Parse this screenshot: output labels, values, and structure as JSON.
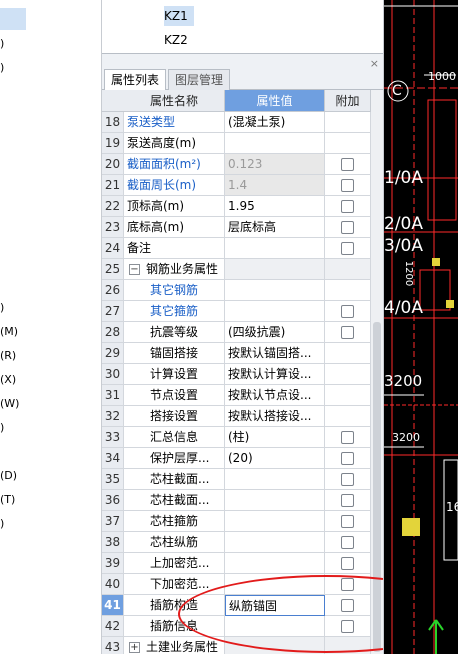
{
  "left_menu": {
    "items": [
      {
        "label": ")"
      },
      {
        "label": ")"
      },
      {
        "label": ")"
      },
      {
        "label": "(M)"
      },
      {
        "label": "(R)"
      },
      {
        "label": "(X)"
      },
      {
        "label": "(W)"
      },
      {
        "label": ")"
      },
      {
        "label": "(D)"
      },
      {
        "label": "(T)"
      },
      {
        "label": ")"
      }
    ]
  },
  "component_list": {
    "items": [
      {
        "label": "KZ1",
        "selected": true
      },
      {
        "label": "KZ2",
        "selected": false
      }
    ]
  },
  "panel": {
    "close_glyph": "×",
    "tabs": [
      {
        "label": "属性列表",
        "active": true
      },
      {
        "label": "图层管理",
        "active": false
      }
    ],
    "headers": {
      "name": "属性名称",
      "value": "属性值",
      "add": "附加"
    }
  },
  "rows": [
    {
      "num": "18",
      "name": "泵送类型",
      "value": "(混凝土泵)",
      "checkbox": false,
      "style": "blue"
    },
    {
      "num": "19",
      "name": "泵送高度(m)",
      "value": "",
      "checkbox": false,
      "style": ""
    },
    {
      "num": "20",
      "name": "截面面积(m²)",
      "value": "0.123",
      "checkbox": true,
      "style": "blue grey"
    },
    {
      "num": "21",
      "name": "截面周长(m)",
      "value": "1.4",
      "checkbox": true,
      "style": "blue grey"
    },
    {
      "num": "22",
      "name": "顶标高(m)",
      "value": "1.95",
      "checkbox": true,
      "style": ""
    },
    {
      "num": "23",
      "name": "底标高(m)",
      "value": "层底标高",
      "checkbox": true,
      "style": ""
    },
    {
      "num": "24",
      "name": "备注",
      "value": "",
      "checkbox": true,
      "style": ""
    },
    {
      "num": "25",
      "name": "钢筋业务属性",
      "value": "",
      "checkbox": false,
      "style": "group",
      "expander": "−"
    },
    {
      "num": "26",
      "name": "其它钢筋",
      "value": "",
      "checkbox": false,
      "style": "blue indent1"
    },
    {
      "num": "27",
      "name": "其它箍筋",
      "value": "",
      "checkbox": true,
      "style": "blue indent1"
    },
    {
      "num": "28",
      "name": "抗震等级",
      "value": "(四级抗震)",
      "checkbox": true,
      "style": "indent1"
    },
    {
      "num": "29",
      "name": "锚固搭接",
      "value": "按默认锚固搭...",
      "checkbox": false,
      "style": "indent1"
    },
    {
      "num": "30",
      "name": "计算设置",
      "value": "按默认计算设...",
      "checkbox": false,
      "style": "indent1"
    },
    {
      "num": "31",
      "name": "节点设置",
      "value": "按默认节点设...",
      "checkbox": false,
      "style": "indent1"
    },
    {
      "num": "32",
      "name": "搭接设置",
      "value": "按默认搭接设...",
      "checkbox": false,
      "style": "indent1"
    },
    {
      "num": "33",
      "name": "汇总信息",
      "value": "(柱)",
      "checkbox": true,
      "style": "indent1"
    },
    {
      "num": "34",
      "name": "保护层厚...",
      "value": "(20)",
      "checkbox": true,
      "style": "indent1"
    },
    {
      "num": "35",
      "name": "芯柱截面...",
      "value": "",
      "checkbox": true,
      "style": "indent1"
    },
    {
      "num": "36",
      "name": "芯柱截面...",
      "value": "",
      "checkbox": true,
      "style": "indent1"
    },
    {
      "num": "37",
      "name": "芯柱箍筋",
      "value": "",
      "checkbox": true,
      "style": "indent1"
    },
    {
      "num": "38",
      "name": "芯柱纵筋",
      "value": "",
      "checkbox": true,
      "style": "indent1"
    },
    {
      "num": "39",
      "name": "上加密范...",
      "value": "",
      "checkbox": true,
      "style": "indent1"
    },
    {
      "num": "40",
      "name": "下加密范...",
      "value": "",
      "checkbox": true,
      "style": "indent1"
    },
    {
      "num": "41",
      "name": "插筋构造",
      "value": "纵筋锚固",
      "checkbox": true,
      "style": "indent1 hl"
    },
    {
      "num": "42",
      "name": "插筋信息",
      "value": "",
      "checkbox": true,
      "style": "indent1"
    },
    {
      "num": "43",
      "name": "土建业务属性",
      "value": "",
      "checkbox": false,
      "style": "group",
      "expander": "+"
    }
  ],
  "cad": {
    "accent": "#ff2a2a",
    "labels": [
      {
        "text": "C"
      },
      {
        "text": "1000"
      },
      {
        "text": "1/0A"
      },
      {
        "text": "2/0A"
      },
      {
        "text": "3/0A"
      },
      {
        "text": "1200"
      },
      {
        "text": "4/0A"
      },
      {
        "text": "3200"
      },
      {
        "text": "3200"
      },
      {
        "text": "16"
      },
      {
        "text": "1000"
      }
    ]
  }
}
